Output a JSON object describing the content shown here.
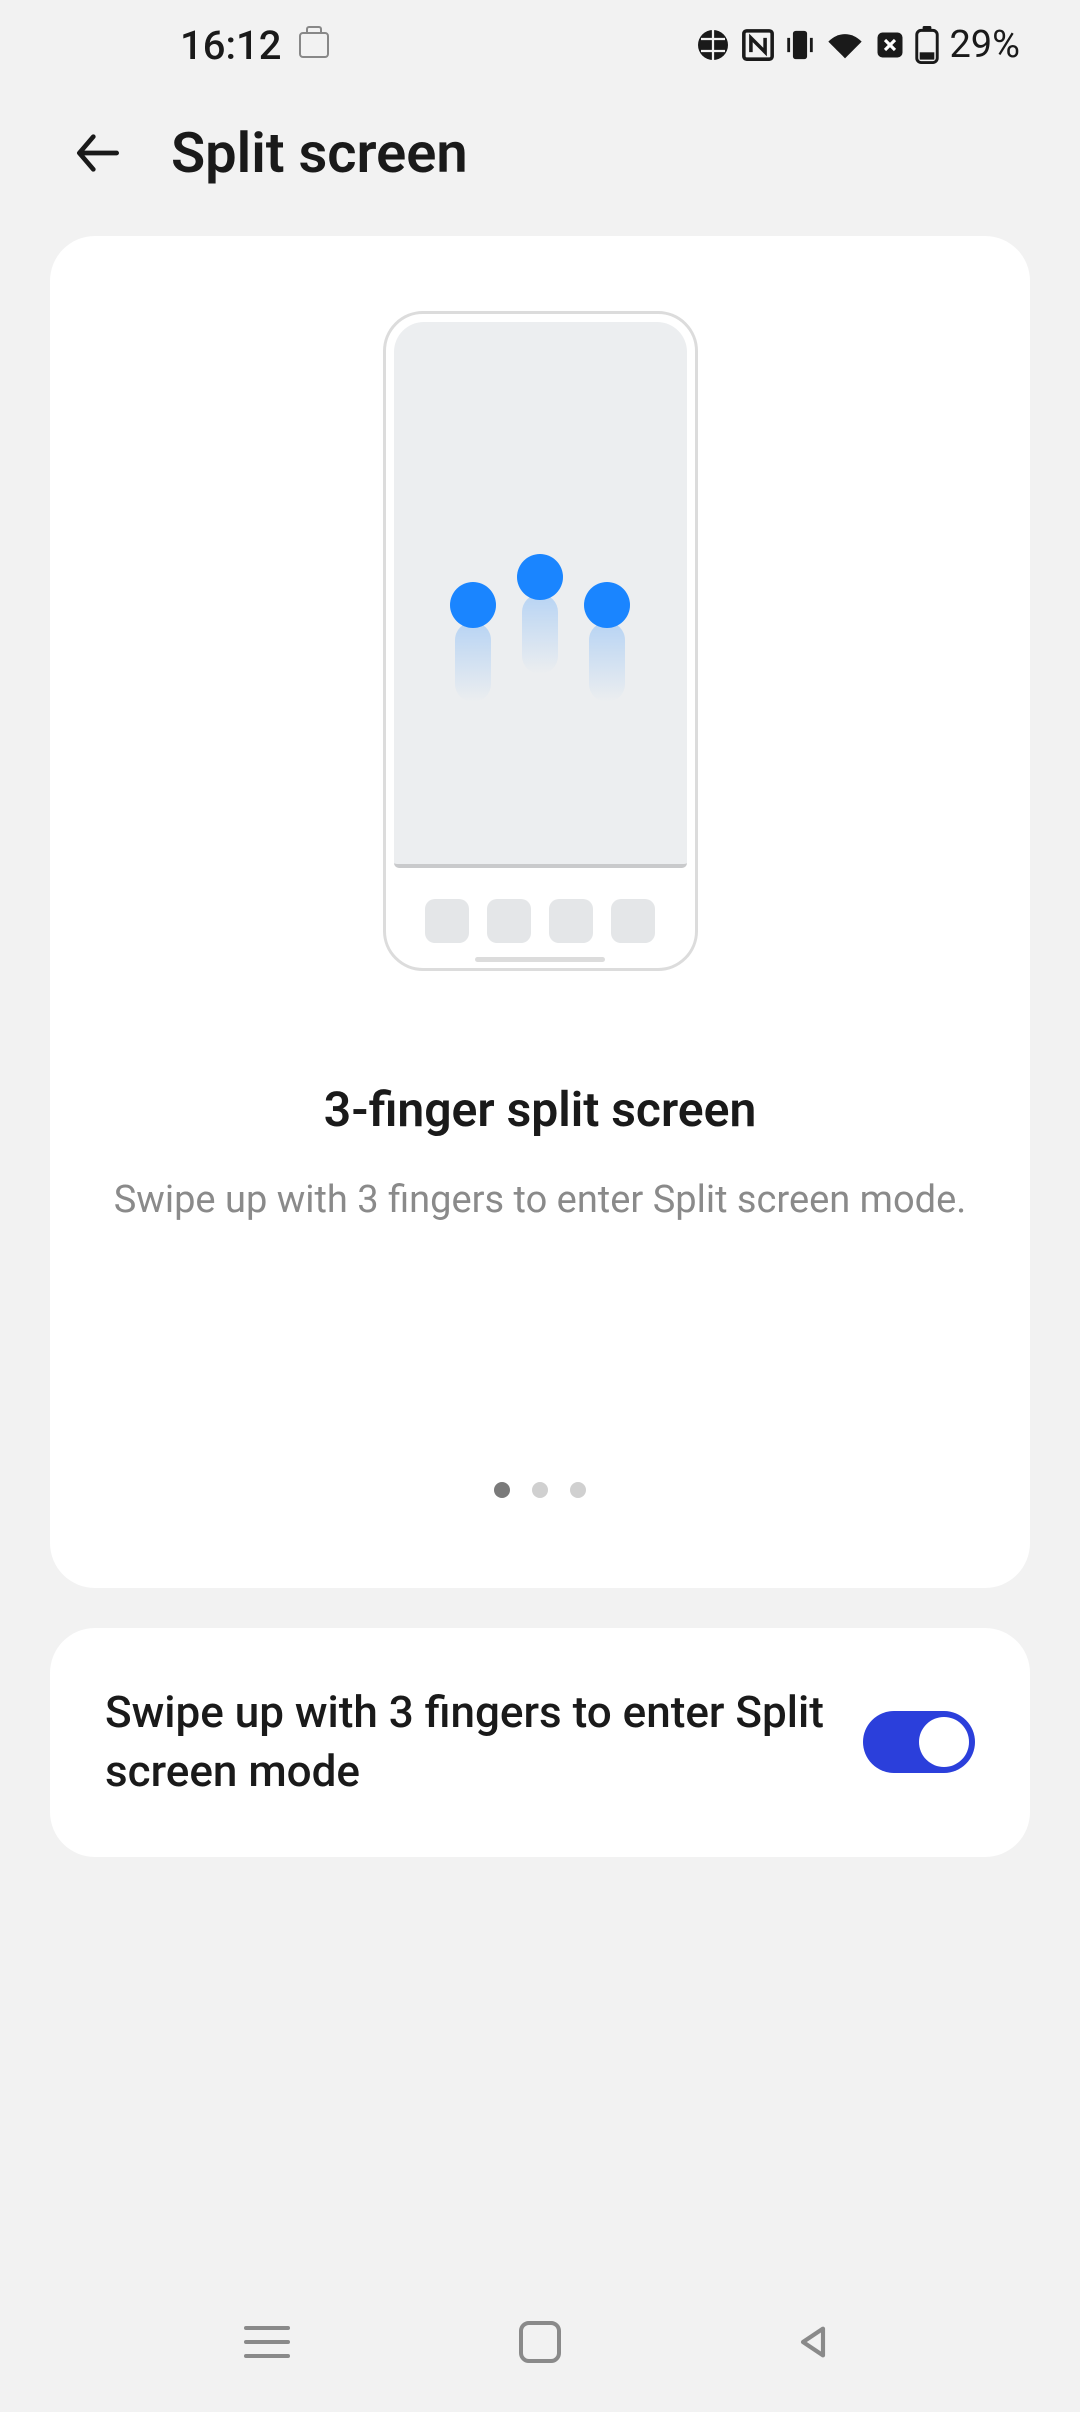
{
  "status": {
    "time": "16:12",
    "battery_text": "29%"
  },
  "header": {
    "title": "Split screen"
  },
  "card": {
    "title": "3-finger split screen",
    "description": "Swipe up with 3 fingers to enter Split screen mode.",
    "pager": {
      "count": 3,
      "active_index": 0
    }
  },
  "setting": {
    "label": "Swipe up with 3 fingers to enter Split screen mode",
    "enabled": true
  }
}
